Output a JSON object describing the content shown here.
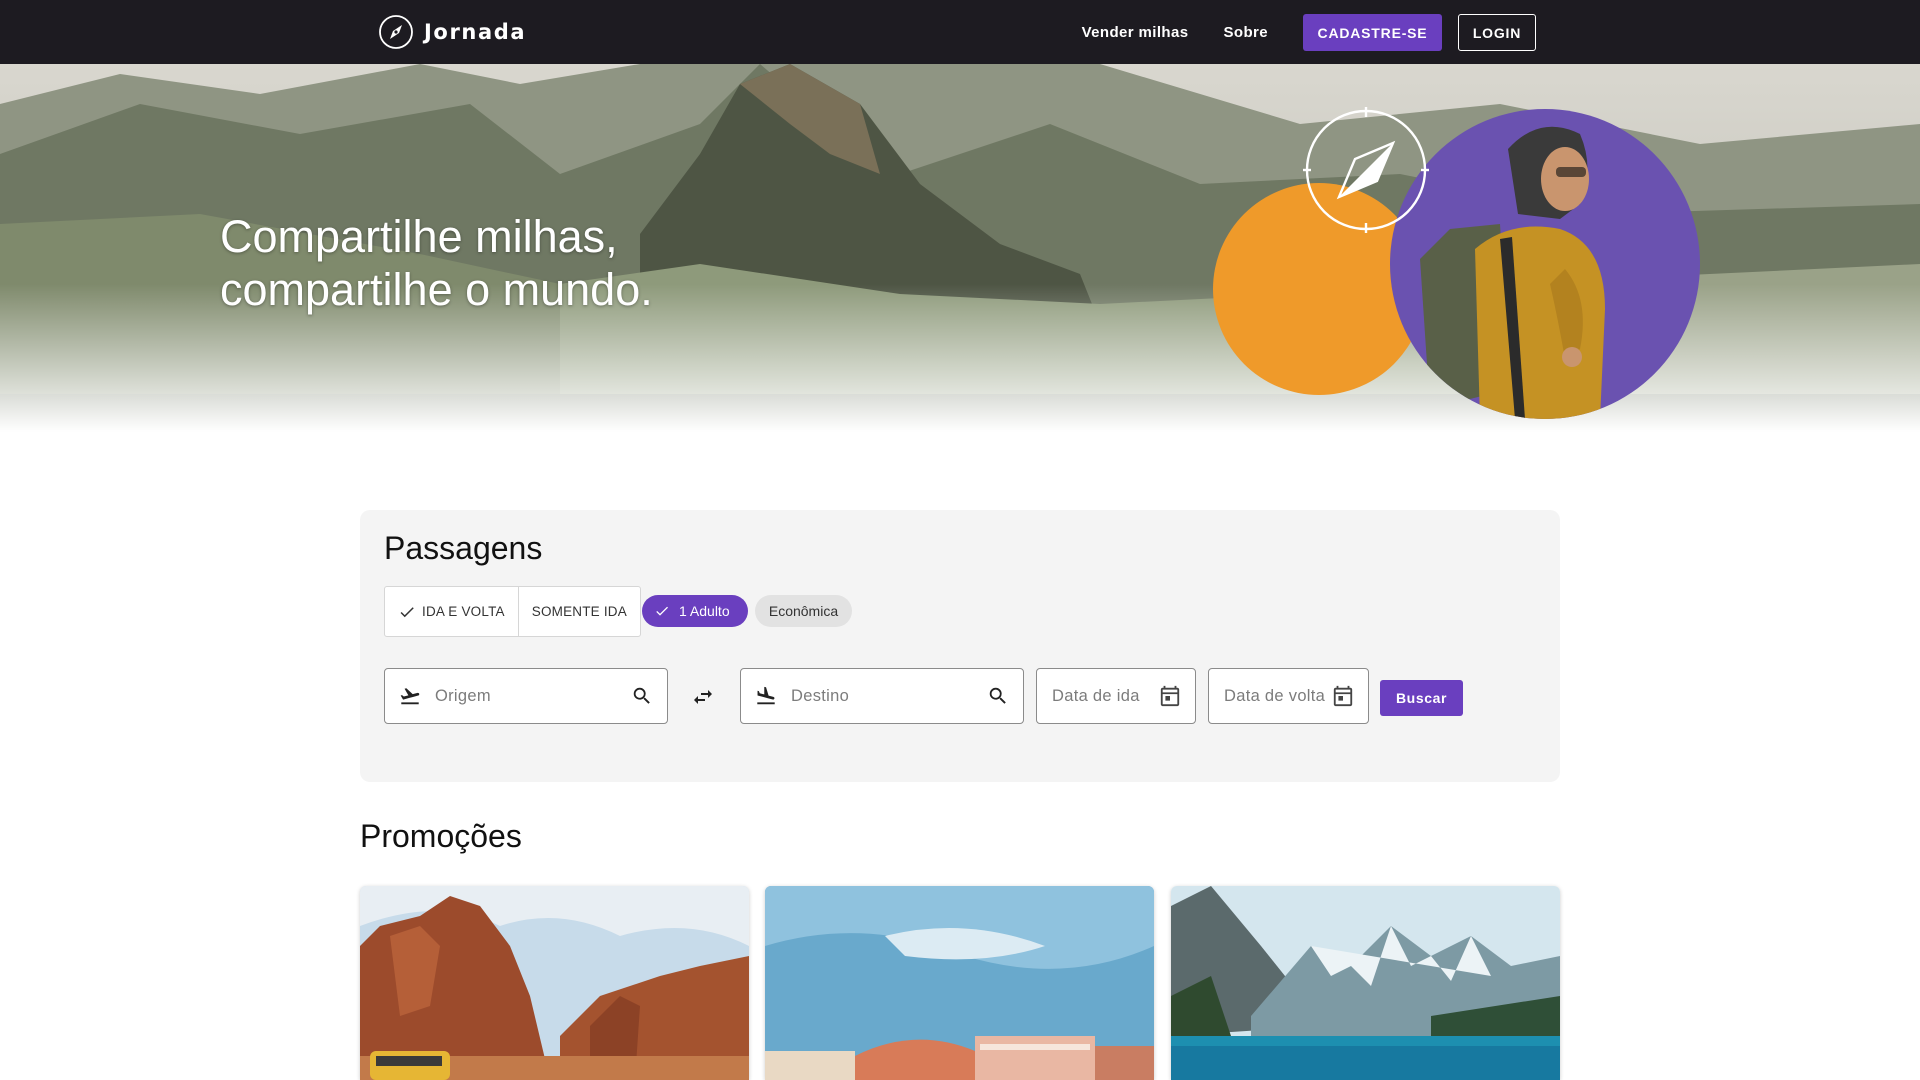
{
  "header": {
    "brand": "Jornada",
    "nav": {
      "sell_miles": "Vender milhas",
      "about": "Sobre",
      "signup": "CADASTRE-SE",
      "login": "LOGIN"
    }
  },
  "hero": {
    "title_line1": "Compartilhe milhas,",
    "title_line2": "compartilhe o mundo."
  },
  "search": {
    "title": "Passagens",
    "trip_types": [
      {
        "label": "IDA E VOLTA",
        "selected": true
      },
      {
        "label": "SOMENTE IDA",
        "selected": false
      }
    ],
    "passengers": "1 Adulto",
    "cabin_class": "Econômica",
    "origin_placeholder": "Origem",
    "destination_placeholder": "Destino",
    "departure_placeholder": "Data de ida",
    "return_placeholder": "Data de volta",
    "submit": "Buscar"
  },
  "promotions": {
    "title": "Promoções",
    "cards": [
      {
        "image": "red-rock-canyon-van"
      },
      {
        "image": "venice-grand-canal"
      },
      {
        "image": "mountain-lake"
      }
    ]
  },
  "colors": {
    "header_bg": "#1d1b21",
    "accent_purple": "#6a3fbf",
    "hero_orange": "#ef9a2a",
    "hero_purple": "#6a52b0",
    "card_bg": "#f4f4f4"
  },
  "icons": {
    "logo": "compass-icon",
    "check": "check-icon",
    "takeoff": "flight-takeoff-icon",
    "landing": "flight-land-icon",
    "search": "search-icon",
    "swap": "swap-horizontal-icon",
    "calendar": "calendar-icon"
  }
}
